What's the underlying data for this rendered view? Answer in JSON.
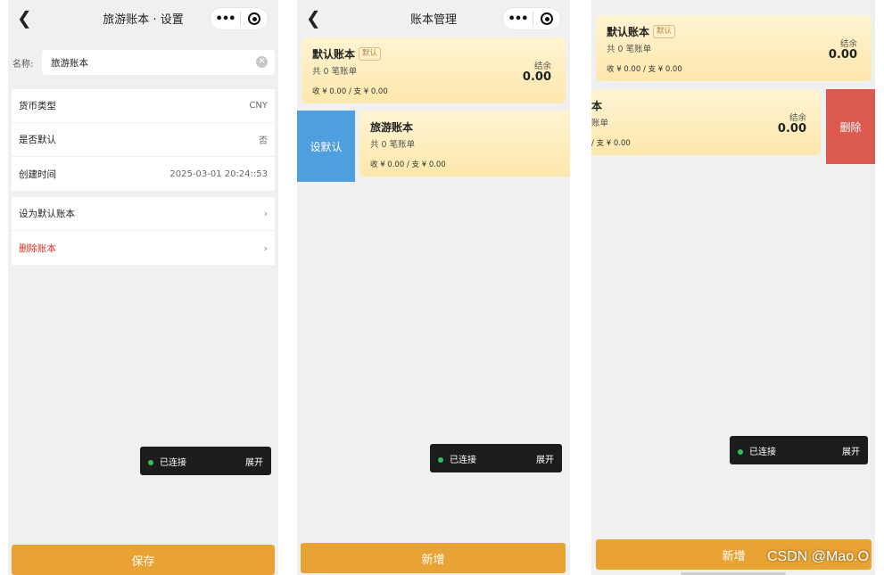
{
  "screen1": {
    "title": "旅游账本 · 设置",
    "name_label": "名称:",
    "name_value": "旅游账本",
    "info_rows": [
      {
        "label": "货币类型",
        "value": "CNY"
      },
      {
        "label": "是否默认",
        "value": "否"
      },
      {
        "label": "创建时间",
        "value": "2025-03-01 20:24::53"
      }
    ],
    "action_rows": [
      {
        "label": "设为默认账本",
        "chevron": "›"
      },
      {
        "label": "删除账本",
        "chevron": "›"
      }
    ],
    "toast": {
      "status": "已连接",
      "action": "展开"
    },
    "save_button": "保存"
  },
  "screen2": {
    "title": "账本管理",
    "default_book": {
      "name": "默认账本",
      "badge": "默认",
      "count": "共 0 笔账单",
      "in_out": "收 ¥ 0.00 / 支 ¥ 0.00",
      "balance_label": "结余",
      "balance": "0.00"
    },
    "travel_book": {
      "name": "旅游账本",
      "count": "共 0 笔账单",
      "in_out": "收 ¥ 0.00 / 支 ¥ 0.00"
    },
    "set_default_button": "设默认",
    "toast": {
      "status": "已连接",
      "action": "展开"
    },
    "add_button": "新增"
  },
  "screen3": {
    "default_book": {
      "name": "默认账本",
      "badge": "默认",
      "count": "共 0 笔账单",
      "in_out": "收 ¥ 0.00 / 支 ¥ 0.00",
      "balance_label": "结余",
      "balance": "0.00"
    },
    "travel_book": {
      "name": "本",
      "count": "账单",
      "in_out": "/ 支 ¥ 0.00",
      "balance_label": "结余",
      "balance": "0.00"
    },
    "delete_button": "删除",
    "toast": {
      "status": "已连接",
      "action": "展开"
    },
    "add_button": "新增"
  },
  "watermark": "CSDN @Mao.O",
  "colors": {
    "accent": "#e8a334",
    "set_default": "#4f9fde",
    "delete": "#dc5a50",
    "danger_text": "#e02e24",
    "toast_bg": "#1c1c1c",
    "connected_dot": "#2fc25b"
  }
}
